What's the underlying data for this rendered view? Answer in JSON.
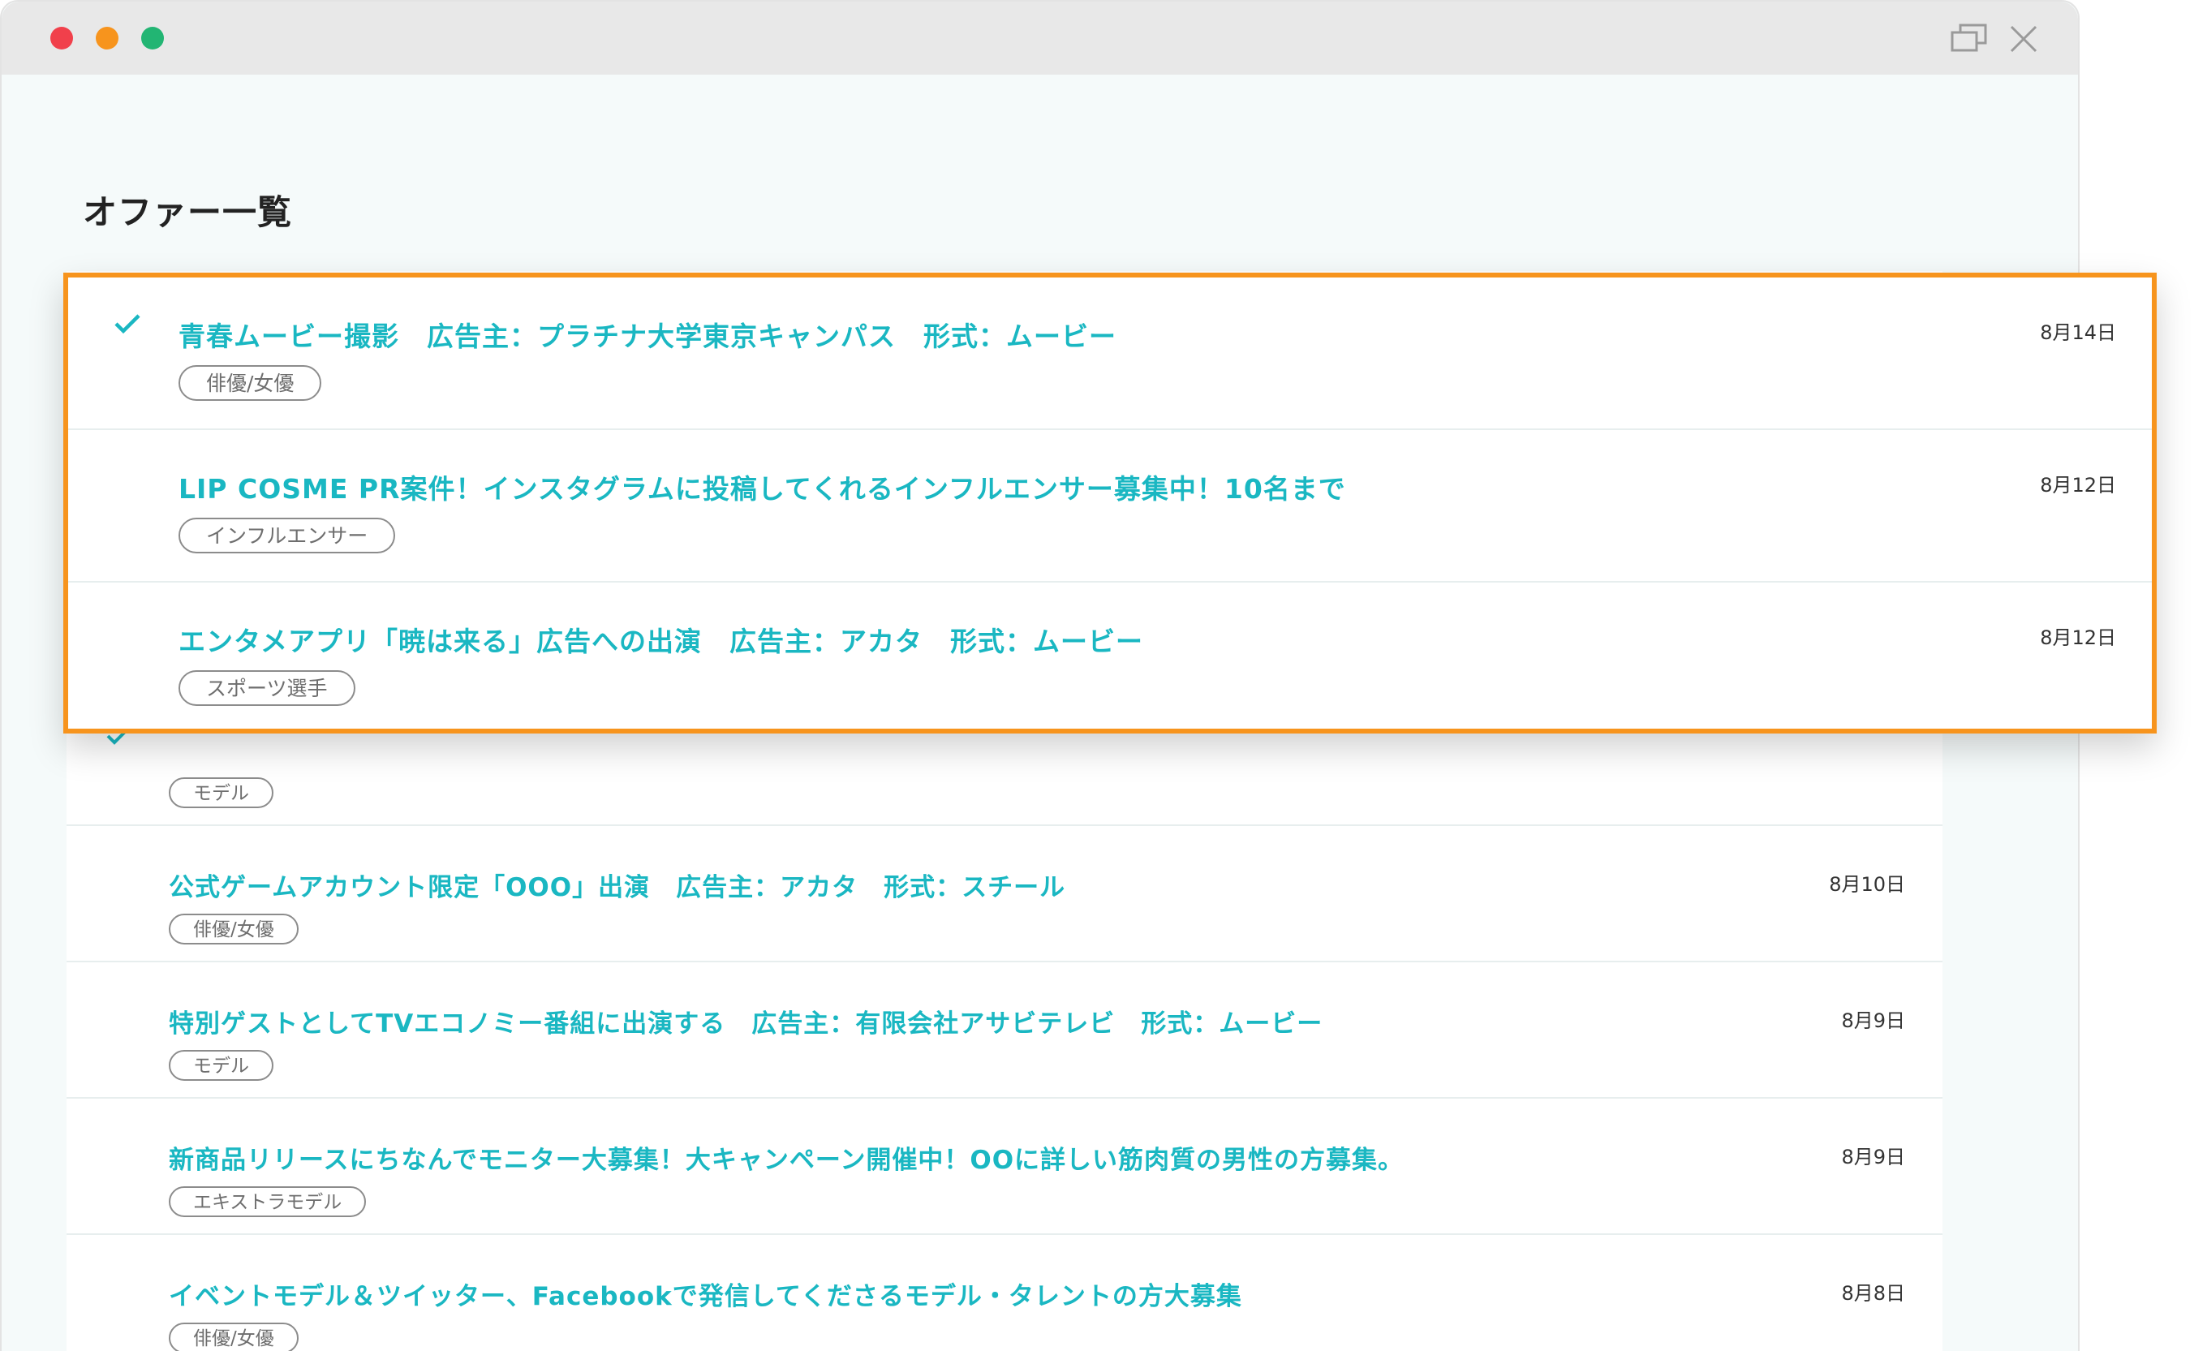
{
  "window": {
    "colors": {
      "close": "#f1404b",
      "minimize": "#f7941d",
      "maximize": "#22b573"
    },
    "controls": [
      "restore-icon",
      "close-icon"
    ]
  },
  "page": {
    "title": "オファー一覧"
  },
  "accent": "#1ab7c2",
  "highlight_color": "#f7941d",
  "highlighted_offers": [
    {
      "checked": true,
      "title": "青春ムービー撮影　広告主：プラチナ大学東京キャンパス　形式：ムービー",
      "tag": "俳優/女優",
      "date": "8月14日"
    },
    {
      "checked": false,
      "title": "LIP COSME PR案件！インスタグラムに投稿してくれるインフルエンサー募集中！10名まで",
      "tag": "インフルエンサー",
      "date": "8月12日"
    },
    {
      "checked": false,
      "title": "エンタメアプリ「暁は来る」広告への出演　広告主：アカタ　形式：ムービー",
      "tag": "スポーツ選手",
      "date": "8月12日"
    }
  ],
  "offers": [
    {
      "title": "公式ゲームアカウント限定「OOO」出演　広告主：アカタ　形式：スチール",
      "tag": "俳優/女優",
      "date": "8月10日"
    },
    {
      "title": "特別ゲストとしてTVエコノミー番組に出演する　広告主：有限会社アサビテレビ　形式：ムービー",
      "tag": "モデル",
      "date": "8月9日"
    },
    {
      "title": "新商品リリースにちなんでモニター大募集！大キャンペーン開催中！OOに詳しい筋肉質の男性の方募集。",
      "tag": "エキストラモデル",
      "date": "8月9日"
    },
    {
      "title": "イベントモデル＆ツイッター、Facebookで発信してくださるモデル・タレントの方大募集",
      "tag": "俳優/女優",
      "date": "8月8日"
    }
  ],
  "partial_offer": {
    "tag": "モデル"
  }
}
